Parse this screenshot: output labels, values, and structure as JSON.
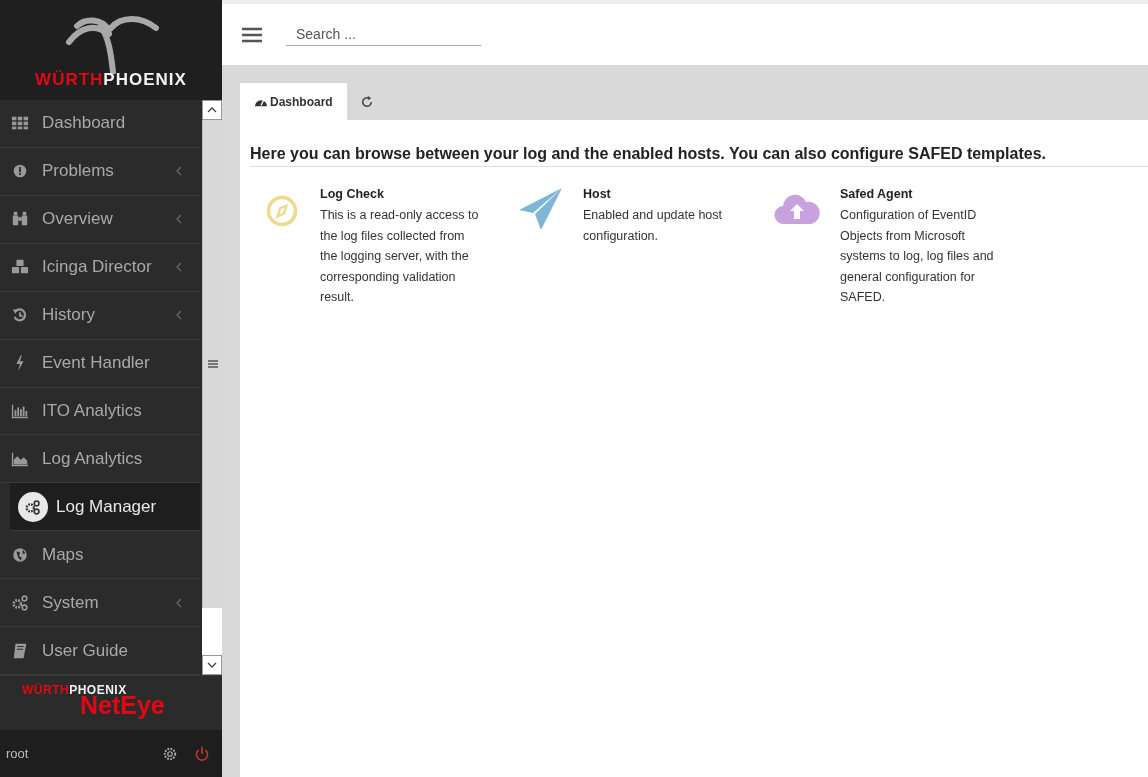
{
  "sidebar": {
    "logo": {
      "brand_red": "WÜRTH",
      "brand_white": "PHOENIX"
    },
    "items": [
      {
        "label": "Dashboard",
        "has_submenu": false,
        "selected": false
      },
      {
        "label": "Problems",
        "has_submenu": true,
        "selected": false
      },
      {
        "label": "Overview",
        "has_submenu": true,
        "selected": false
      },
      {
        "label": "Icinga Director",
        "has_submenu": true,
        "selected": false
      },
      {
        "label": "History",
        "has_submenu": true,
        "selected": false
      },
      {
        "label": "Event Handler",
        "has_submenu": false,
        "selected": false
      },
      {
        "label": "ITO Analytics",
        "has_submenu": false,
        "selected": false
      },
      {
        "label": "Log Analytics",
        "has_submenu": false,
        "selected": false
      },
      {
        "label": "Log Manager",
        "has_submenu": false,
        "selected": true
      },
      {
        "label": "Maps",
        "has_submenu": false,
        "selected": false
      },
      {
        "label": "System",
        "has_submenu": true,
        "selected": false
      },
      {
        "label": "User Guide",
        "has_submenu": false,
        "selected": false
      }
    ],
    "product_logo": {
      "brand_red": "WÜRTH",
      "brand_white": "PHOENIX",
      "product": "NetEye"
    },
    "footer": {
      "user": "root"
    }
  },
  "search": {
    "placeholder": "Search ..."
  },
  "tabs": [
    {
      "label": "Dashboard",
      "selected": true
    }
  ],
  "heading": "Here you can browse between your log and the enabled hosts. You can also configure SAFED templates.",
  "cards": [
    {
      "title": "Log Check",
      "text": "This is a read-only access to the log files collected from the logging server, with the corresponding validation result."
    },
    {
      "title": "Host",
      "text": "Enabled and update host configuration."
    },
    {
      "title": "Safed Agent",
      "text": "Configuration of EventID Objects from Microsoft systems to log, log files and general configuration for SAFED."
    }
  ]
}
